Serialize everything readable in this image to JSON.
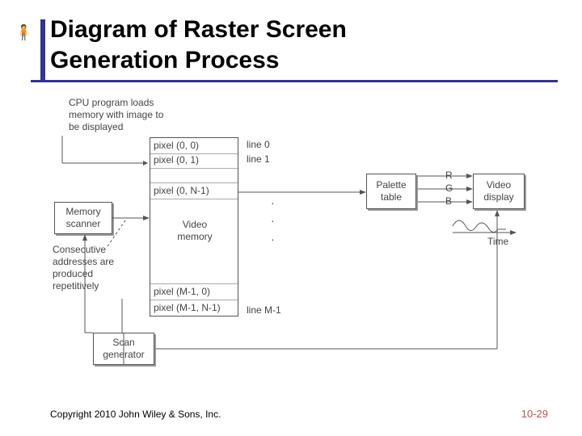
{
  "title": "Diagram of Raster Screen\nGeneration Process",
  "footer": {
    "copyright": "Copyright 2010 John Wiley & Sons, Inc.",
    "page": "10-29"
  },
  "annotations": {
    "cpu": "CPU program loads\nmemory with image to\nbe displayed",
    "consecutive": "Consecutive\naddresses are\nproduced\nrepetitively"
  },
  "boxes": {
    "memory_scanner": "Memory\nscanner",
    "scan_generator": "Scan\ngenerator",
    "palette_table": "Palette\ntable",
    "video_display": "Video\ndisplay",
    "video_memory": "Video\nmemory"
  },
  "pixels": {
    "p00": "pixel (0, 0)",
    "p01": "pixel (0, 1)",
    "p0n1": "pixel (0, N-1)",
    "pm10": "pixel (M-1, 0)",
    "pm1n1": "pixel (M-1, N-1)"
  },
  "lines": {
    "l0": "line 0",
    "l1": "line 1",
    "lm1": "line M-1"
  },
  "rgb": {
    "r": "R",
    "g": "G",
    "b": "B",
    "time": "Time"
  }
}
